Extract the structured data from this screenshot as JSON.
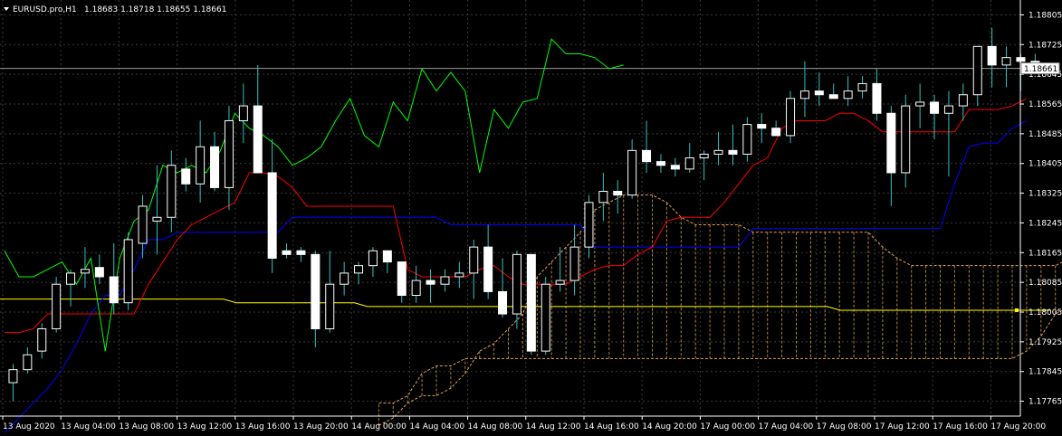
{
  "title": {
    "symbol": "EURUSD.pro,H1",
    "ohlc": "1.18683 1.18718 1.18655 1.18661"
  },
  "current_price": "1.18661",
  "colors": {
    "background": "#000000",
    "grid": "#3a3a3a",
    "axis": "#ffffff",
    "bull_body": "#000000",
    "bear_body": "#ffffff",
    "wick": "#2ec4c4",
    "tenkan": "#ff0000",
    "kijun": "#0000ff",
    "chikou": "#00ff00",
    "ma": "#ffff00",
    "cloud": "#e0a050"
  },
  "chart_data": {
    "type": "candlestick",
    "indicators": [
      "Ichimoku Kinko Hyo",
      "Moving Average"
    ],
    "y_ticks": [
      "1.18805",
      "1.18725",
      "1.18645",
      "1.18565",
      "1.18485",
      "1.18405",
      "1.18325",
      "1.18245",
      "1.18165",
      "1.18085",
      "1.18005",
      "1.17925",
      "1.17845",
      "1.17765"
    ],
    "x_ticks": [
      "13 Aug 2020",
      "13 Aug 04:00",
      "13 Aug 08:00",
      "13 Aug 12:00",
      "13 Aug 16:00",
      "13 Aug 20:00",
      "14 Aug 00:00",
      "14 Aug 04:00",
      "14 Aug 08:00",
      "14 Aug 12:00",
      "14 Aug 16:00",
      "14 Aug 20:00",
      "17 Aug 00:00",
      "17 Aug 04:00",
      "17 Aug 08:00",
      "17 Aug 12:00",
      "17 Aug 16:00",
      "17 Aug 20:00"
    ],
    "ylim": [
      1.1775,
      1.1885
    ],
    "candles": [
      [
        1.17815,
        1.17865,
        1.17765,
        1.1785
      ],
      [
        1.1785,
        1.1791,
        1.1784,
        1.1789
      ],
      [
        1.179,
        1.17975,
        1.1788,
        1.1796
      ],
      [
        1.1796,
        1.181,
        1.1795,
        1.1808
      ],
      [
        1.1808,
        1.1812,
        1.1802,
        1.1811
      ],
      [
        1.1811,
        1.1818,
        1.1807,
        1.1812
      ],
      [
        1.18125,
        1.1816,
        1.1808,
        1.181
      ],
      [
        1.181,
        1.1819,
        1.18,
        1.1803
      ],
      [
        1.1803,
        1.1822,
        1.1801,
        1.182
      ],
      [
        1.1819,
        1.1832,
        1.1815,
        1.1829
      ],
      [
        1.1825,
        1.184,
        1.1816,
        1.1826
      ],
      [
        1.1826,
        1.1844,
        1.1822,
        1.184
      ],
      [
        1.1839,
        1.1842,
        1.1833,
        1.1835
      ],
      [
        1.1835,
        1.1852,
        1.183,
        1.1845
      ],
      [
        1.1845,
        1.1849,
        1.1833,
        1.1834
      ],
      [
        1.1834,
        1.1856,
        1.1828,
        1.1852
      ],
      [
        1.1852,
        1.1862,
        1.1846,
        1.1856
      ],
      [
        1.1856,
        1.1867,
        1.1839,
        1.1838
      ],
      [
        1.1838,
        1.1847,
        1.1811,
        1.1815
      ],
      [
        1.1817,
        1.1819,
        1.1815,
        1.1816
      ],
      [
        1.1817,
        1.1818,
        1.1814,
        1.1816
      ],
      [
        1.1816,
        1.1817,
        1.1791,
        1.1796
      ],
      [
        1.1796,
        1.1817,
        1.1795,
        1.1808
      ],
      [
        1.1808,
        1.1814,
        1.1805,
        1.1811
      ],
      [
        1.1811,
        1.1814,
        1.1808,
        1.1813
      ],
      [
        1.1813,
        1.1818,
        1.181,
        1.1817
      ],
      [
        1.1817,
        1.1817,
        1.1811,
        1.1814
      ],
      [
        1.1814,
        1.1814,
        1.1803,
        1.1805
      ],
      [
        1.1805,
        1.1813,
        1.1803,
        1.1809
      ],
      [
        1.1809,
        1.1812,
        1.1803,
        1.1808
      ],
      [
        1.1808,
        1.1812,
        1.1806,
        1.181
      ],
      [
        1.181,
        1.1814,
        1.1807,
        1.1811
      ],
      [
        1.1811,
        1.182,
        1.1804,
        1.1818
      ],
      [
        1.1818,
        1.1824,
        1.1804,
        1.1806
      ],
      [
        1.1806,
        1.1815,
        1.1799,
        1.18
      ],
      [
        1.18,
        1.1817,
        1.1796,
        1.1816
      ],
      [
        1.1816,
        1.1816,
        1.1789,
        1.179
      ],
      [
        1.179,
        1.181,
        1.1789,
        1.1808
      ],
      [
        1.1808,
        1.1818,
        1.1806,
        1.1809
      ],
      [
        1.1809,
        1.1824,
        1.1805,
        1.1818
      ],
      [
        1.1818,
        1.1832,
        1.1815,
        1.183
      ],
      [
        1.183,
        1.1838,
        1.1825,
        1.1833
      ],
      [
        1.1833,
        1.1836,
        1.1827,
        1.1832
      ],
      [
        1.1832,
        1.1847,
        1.1831,
        1.1844
      ],
      [
        1.1844,
        1.1852,
        1.1838,
        1.1841
      ],
      [
        1.1841,
        1.1843,
        1.1838,
        1.184
      ],
      [
        1.184,
        1.1842,
        1.1837,
        1.1839
      ],
      [
        1.1839,
        1.1846,
        1.1838,
        1.1842
      ],
      [
        1.1842,
        1.1844,
        1.1836,
        1.1843
      ],
      [
        1.1843,
        1.1849,
        1.184,
        1.1844
      ],
      [
        1.1844,
        1.1851,
        1.184,
        1.1843
      ],
      [
        1.1843,
        1.1853,
        1.1841,
        1.1851
      ],
      [
        1.1851,
        1.1854,
        1.1846,
        1.185
      ],
      [
        1.185,
        1.1852,
        1.1848,
        1.1848
      ],
      [
        1.1848,
        1.186,
        1.1846,
        1.1858
      ],
      [
        1.1858,
        1.1868,
        1.1853,
        1.186
      ],
      [
        1.186,
        1.1865,
        1.1856,
        1.1859
      ],
      [
        1.1859,
        1.1862,
        1.1858,
        1.1858
      ],
      [
        1.1858,
        1.1864,
        1.1856,
        1.186
      ],
      [
        1.186,
        1.1864,
        1.1858,
        1.1862
      ],
      [
        1.1862,
        1.1866,
        1.1852,
        1.1854
      ],
      [
        1.1854,
        1.1856,
        1.1829,
        1.1838
      ],
      [
        1.1838,
        1.1859,
        1.1834,
        1.1856
      ],
      [
        1.1856,
        1.1862,
        1.185,
        1.1857
      ],
      [
        1.1857,
        1.1859,
        1.1847,
        1.1854
      ],
      [
        1.1854,
        1.186,
        1.1837,
        1.1856
      ],
      [
        1.1856,
        1.1862,
        1.1852,
        1.1859
      ],
      [
        1.1859,
        1.1872,
        1.1856,
        1.1872
      ],
      [
        1.1872,
        1.1877,
        1.1861,
        1.1867
      ],
      [
        1.1867,
        1.1872,
        1.1861,
        1.1869
      ],
      [
        1.1869,
        1.187,
        1.186,
        1.1868
      ],
      [
        1.1868,
        1.187,
        1.1865,
        1.18661
      ]
    ],
    "tenkan": [
      1.1795,
      1.1795,
      1.1796,
      1.18,
      1.18,
      1.18,
      1.18,
      1.18,
      1.18,
      1.18,
      1.1808,
      1.1814,
      1.182,
      1.1824,
      1.1826,
      1.1828,
      1.183,
      1.1838,
      1.1838,
      1.1837,
      1.1834,
      1.1829,
      1.1829,
      1.1829,
      1.1829,
      1.1829,
      1.1829,
      1.1829,
      1.1812,
      1.181,
      1.181,
      1.181,
      1.181,
      1.1812,
      1.1813,
      1.181,
      1.1808,
      1.1808,
      1.1808,
      1.1808,
      1.181,
      1.1812,
      1.1813,
      1.1813,
      1.1816,
      1.1818,
      1.1825,
      1.1826,
      1.1826,
      1.1826,
      1.183,
      1.1835,
      1.184,
      1.1842,
      1.185,
      1.1852,
      1.1852,
      1.1852,
      1.1854,
      1.1854,
      1.1852,
      1.1849,
      1.1849,
      1.1849,
      1.1849,
      1.1849,
      1.1849,
      1.1855,
      1.1855,
      1.1855,
      1.1856,
      1.1858
    ],
    "kijun": [
      1.1768,
      1.1772,
      1.1776,
      1.178,
      1.1785,
      1.1792,
      1.18,
      1.1805,
      1.1805,
      1.1812,
      1.182,
      1.182,
      1.1822,
      1.1822,
      1.1822,
      1.1822,
      1.1822,
      1.1822,
      1.1822,
      1.1822,
      1.1826,
      1.1826,
      1.1826,
      1.1826,
      1.1826,
      1.1826,
      1.1826,
      1.1826,
      1.1826,
      1.1826,
      1.1826,
      1.1824,
      1.1824,
      1.1824,
      1.1824,
      1.1824,
      1.1824,
      1.1824,
      1.1824,
      1.1824,
      1.1824,
      1.1818,
      1.1818,
      1.1818,
      1.1818,
      1.1818,
      1.1818,
      1.1818,
      1.1818,
      1.1818,
      1.1818,
      1.1818,
      1.1823,
      1.1823,
      1.1823,
      1.1823,
      1.1823,
      1.1823,
      1.1823,
      1.1823,
      1.1823,
      1.1823,
      1.1823,
      1.1823,
      1.1823,
      1.1823,
      1.1835,
      1.1845,
      1.1846,
      1.1846,
      1.185,
      1.1852
    ],
    "chikou": [
      1.1817,
      1.181,
      1.181,
      1.1812,
      1.1814,
      1.1808,
      1.1815,
      1.179,
      1.1815,
      1.1825,
      1.1828,
      1.184,
      1.1838,
      1.184,
      1.1838,
      1.1844,
      1.1854,
      1.185,
      1.1848,
      1.1845,
      1.184,
      1.1842,
      1.1845,
      1.1852,
      1.1858,
      1.1848,
      1.1845,
      1.1857,
      1.1852,
      1.1866,
      1.186,
      1.1865,
      1.186,
      1.1838,
      1.1855,
      1.185,
      1.1857,
      1.1858,
      1.1874,
      1.187,
      1.187,
      1.1869,
      1.1866,
      1.1867
    ],
    "ma": [
      1.1804,
      1.1804,
      1.1804,
      1.1804,
      1.1804,
      1.1804,
      1.1804,
      1.1804,
      1.1804,
      1.1804,
      1.1804,
      1.1804,
      1.1804,
      1.1804,
      1.1804,
      1.1804,
      1.1804,
      1.1804,
      1.1803,
      1.1803,
      1.1803,
      1.1803,
      1.1803,
      1.1803,
      1.1803,
      1.1803,
      1.1803,
      1.1803,
      1.1802,
      1.1802,
      1.1802,
      1.1802,
      1.1802,
      1.1802,
      1.1802,
      1.1802,
      1.1802,
      1.1802,
      1.1802,
      1.1802,
      1.1802,
      1.1802,
      1.1802,
      1.1802,
      1.1802,
      1.1802,
      1.1802,
      1.1802,
      1.1802,
      1.1802,
      1.1802,
      1.1802,
      1.1802,
      1.1802,
      1.1802,
      1.1802,
      1.1802,
      1.1802,
      1.1802,
      1.1802,
      1.1802,
      1.1802,
      1.1802,
      1.1802,
      1.1801,
      1.1801,
      1.1801,
      1.1801,
      1.1801,
      1.1801,
      1.1801,
      1.1801,
      1.1801,
      1.1801,
      1.1801,
      1.1801,
      1.1801,
      1.1801,
      1.1801,
      1.1801,
      1.1801
    ],
    "span_a": [
      1.177,
      1.1772,
      1.1776,
      1.1778,
      1.1778,
      1.178,
      1.1784,
      1.179,
      1.1792,
      1.1796,
      1.18,
      1.181,
      1.1814,
      1.1818,
      1.1822,
      1.1828,
      1.183,
      1.1832,
      1.1832,
      1.1832,
      1.183,
      1.1826,
      1.1824,
      1.1824,
      1.1824,
      1.1824,
      1.1822,
      1.1822,
      1.1822,
      1.1822,
      1.1822,
      1.1822,
      1.1822,
      1.1822,
      1.1822,
      1.1818,
      1.1815,
      1.1813,
      1.1813,
      1.1813,
      1.1813,
      1.1813,
      1.1813,
      1.1813,
      1.1813,
      1.1813,
      1.1813,
      1.1813,
      1.1815,
      1.1816,
      1.1817,
      1.1818,
      1.1819,
      1.1819,
      1.1818,
      1.1818,
      1.1818
    ],
    "span_b": [
      1.1776,
      1.1776,
      1.1778,
      1.1784,
      1.1786,
      1.1786,
      1.1788,
      1.1788,
      1.1788,
      1.1788,
      1.1788,
      1.1788,
      1.1788,
      1.1788,
      1.1788,
      1.1788,
      1.1788,
      1.1788,
      1.1788,
      1.1788,
      1.1788,
      1.1788,
      1.1788,
      1.1788,
      1.1788,
      1.1788,
      1.1788,
      1.1788,
      1.1788,
      1.1788,
      1.1788,
      1.1788,
      1.1788,
      1.1788,
      1.1788,
      1.1788,
      1.1788,
      1.1788,
      1.1788,
      1.1788,
      1.1788,
      1.1788,
      1.1788,
      1.1788,
      1.1788,
      1.179,
      1.1794,
      1.18,
      1.1802,
      1.1806,
      1.1808,
      1.181,
      1.1812,
      1.1813,
      1.1816,
      1.1818,
      1.1818
    ]
  }
}
